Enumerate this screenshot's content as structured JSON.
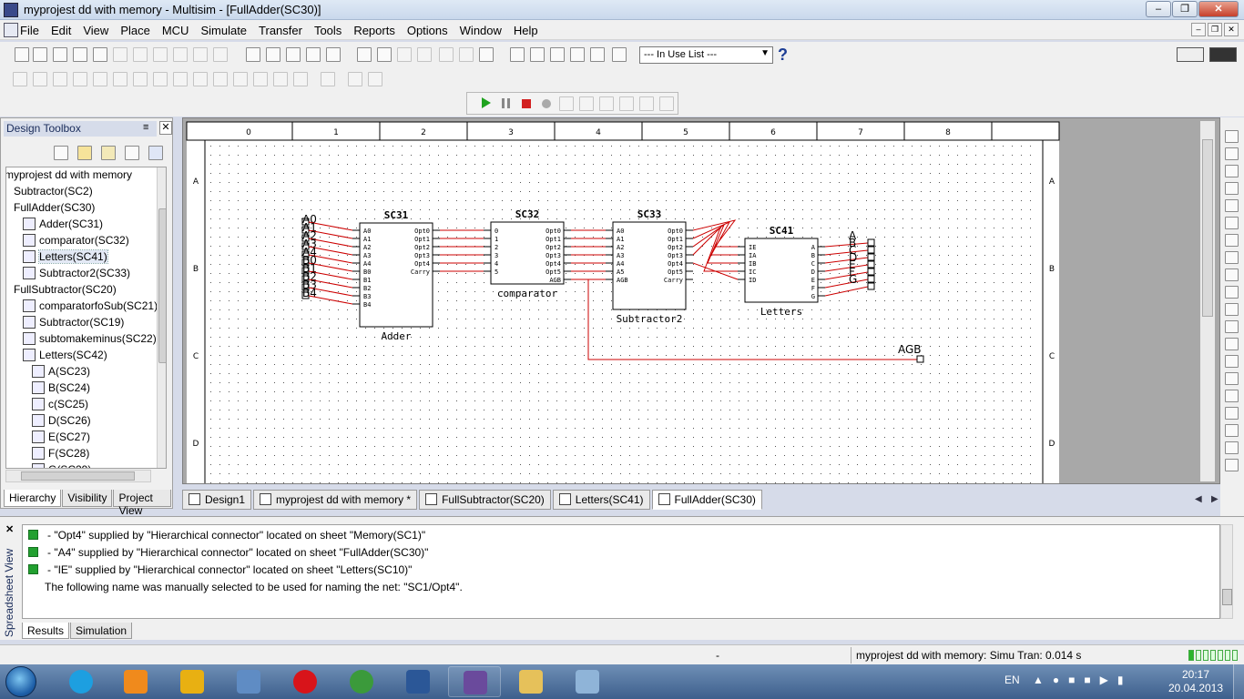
{
  "window": {
    "title": "myprojest dd with memory - Multisim - [FullAdder(SC30)]"
  },
  "menu": [
    "File",
    "Edit",
    "View",
    "Place",
    "MCU",
    "Simulate",
    "Transfer",
    "Tools",
    "Reports",
    "Options",
    "Window",
    "Help"
  ],
  "toolbar": {
    "in_use_list": "--- In Use List ---"
  },
  "design_toolbox": {
    "title": "Design Toolbox",
    "tree": [
      {
        "label": "myprojest dd with memory",
        "indent": 0,
        "icon": false
      },
      {
        "label": "Subtractor(SC2)",
        "indent": 1,
        "icon": false
      },
      {
        "label": "FullAdder(SC30)",
        "indent": 1,
        "icon": false
      },
      {
        "label": "Adder(SC31)",
        "indent": 2,
        "icon": true
      },
      {
        "label": "comparator(SC32)",
        "indent": 2,
        "icon": true
      },
      {
        "label": "Letters(SC41)",
        "indent": 2,
        "icon": true,
        "selected": true
      },
      {
        "label": "Subtractor2(SC33)",
        "indent": 2,
        "icon": true
      },
      {
        "label": "FullSubtractor(SC20)",
        "indent": 1,
        "icon": false
      },
      {
        "label": "comparatorfoSub(SC21)",
        "indent": 2,
        "icon": true
      },
      {
        "label": "Subtractor(SC19)",
        "indent": 2,
        "icon": true
      },
      {
        "label": "subtomakeminus(SC22)",
        "indent": 2,
        "icon": true
      },
      {
        "label": "Letters(SC42)",
        "indent": 2,
        "icon": true
      },
      {
        "label": "A(SC23)",
        "indent": 3,
        "icon": true
      },
      {
        "label": "B(SC24)",
        "indent": 3,
        "icon": true
      },
      {
        "label": "c(SC25)",
        "indent": 3,
        "icon": true
      },
      {
        "label": "D(SC26)",
        "indent": 3,
        "icon": true
      },
      {
        "label": "E(SC27)",
        "indent": 3,
        "icon": true
      },
      {
        "label": "F(SC28)",
        "indent": 3,
        "icon": true
      },
      {
        "label": "G(SC29)",
        "indent": 3,
        "icon": true
      }
    ],
    "tabs": [
      "Hierarchy",
      "Visibility",
      "Project View"
    ]
  },
  "schematic": {
    "ruler_cols": [
      "0",
      "1",
      "2",
      "3",
      "4",
      "5",
      "6",
      "7",
      "8"
    ],
    "ruler_rows": [
      "A",
      "B",
      "C",
      "D"
    ],
    "blocks": [
      {
        "ref": "SC31",
        "name": "Adder",
        "inputs": [
          "A0",
          "A1",
          "A2",
          "A3",
          "A4",
          "B0",
          "B1",
          "B2",
          "B3",
          "B4"
        ],
        "outputs": [
          "Opt0",
          "Opt1",
          "Opt2",
          "Opt3",
          "Opt4",
          "Carry"
        ]
      },
      {
        "ref": "SC32",
        "name": "comparator",
        "inputs": [
          "0",
          "1",
          "2",
          "3",
          "4",
          "5"
        ],
        "outputs": [
          "Opt0",
          "Opt1",
          "Opt2",
          "Opt3",
          "Opt4",
          "Opt5",
          "AGB"
        ]
      },
      {
        "ref": "SC33",
        "name": "Subtractor2",
        "inputs": [
          "A0",
          "A1",
          "A2",
          "A3",
          "A4",
          "A5",
          "AGB"
        ],
        "outputs": [
          "Opt0",
          "Opt1",
          "Opt2",
          "Opt3",
          "Opt4",
          "Opt5",
          "Carry"
        ]
      },
      {
        "ref": "SC41",
        "name": "Letters",
        "inputs": [
          "IE",
          "IA",
          "IB",
          "IC",
          "ID"
        ],
        "outputs": [
          "A",
          "B",
          "C",
          "D",
          "E",
          "F",
          "G"
        ]
      }
    ],
    "input_connectors": [
      "A0",
      "A1",
      "A2",
      "A3",
      "A4",
      "B0",
      "B1",
      "B2",
      "B3",
      "B4"
    ],
    "output_connectors": [
      "A",
      "B",
      "C",
      "D",
      "E",
      "F",
      "G"
    ],
    "agb_label": "AGB"
  },
  "sheet_tabs": [
    {
      "label": "Design1",
      "active": false
    },
    {
      "label": "myprojest dd with memory *",
      "active": false
    },
    {
      "label": "FullSubtractor(SC20)",
      "active": false
    },
    {
      "label": "Letters(SC41)",
      "active": false
    },
    {
      "label": "FullAdder(SC30)",
      "active": true
    }
  ],
  "results": {
    "side_label": "Spreadsheet View",
    "lines": [
      {
        "text": "- \"Opt4\" supplied by \"Hierarchical connector\" located on sheet \"Memory(SC1)\"",
        "icon": true
      },
      {
        "text": "- \"A4\" supplied by \"Hierarchical connector\" located on sheet \"FullAdder(SC30)\"",
        "icon": true
      },
      {
        "text": "- \"IE\" supplied by \"Hierarchical connector\" located on sheet \"Letters(SC10)\"",
        "icon": true
      },
      {
        "text": "The following name was manually selected to be used for naming the net: \"SC1/Opt4\".",
        "icon": false
      }
    ],
    "tabs": [
      "Results",
      "Simulation"
    ]
  },
  "status": {
    "dash": "-",
    "text": "myprojest dd with memory: Simu  Tran: 0.014 s",
    "meter_level": 0.15
  },
  "taskbar": {
    "apps": [
      {
        "name": "skype",
        "color": "#1d9fe0"
      },
      {
        "name": "media",
        "color": "#f08a1c"
      },
      {
        "name": "tool",
        "color": "#e8b012"
      },
      {
        "name": "search",
        "color": "#5f8cc4"
      },
      {
        "name": "opera",
        "color": "#d8141a"
      },
      {
        "name": "chrome",
        "color": "#3b9a3b"
      },
      {
        "name": "word",
        "color": "#2b5797"
      },
      {
        "name": "multisim",
        "color": "#6a4a9c"
      },
      {
        "name": "explorer",
        "color": "#e6c15a"
      },
      {
        "name": "paint",
        "color": "#8fb4d8"
      }
    ],
    "lang": "EN",
    "time": "20:17",
    "date": "20.04.2013"
  }
}
